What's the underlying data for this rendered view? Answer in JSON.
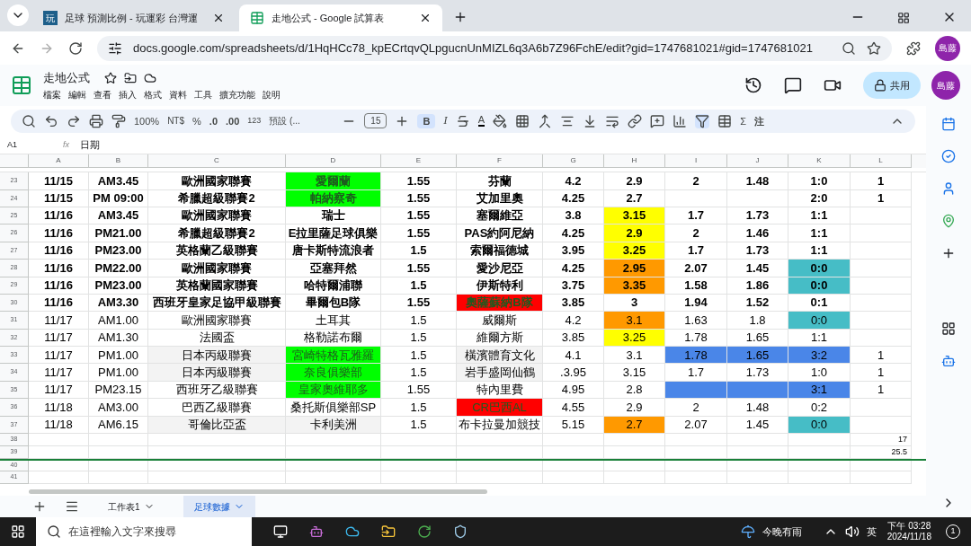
{
  "browser": {
    "tabs": [
      {
        "label": "足球 預測比例 - 玩運彩 台灣運",
        "icon_text": "玩",
        "selected": false
      },
      {
        "label": "走地公式 - Google 試算表",
        "selected": true
      }
    ],
    "url": "docs.google.com/spreadsheets/d/1HqHCc78_kpECrtqvQLpgucnUnMIZL6q3A6b7Z96FchE/edit?gid=1747681021#gid=1747681021",
    "profile": "島藤"
  },
  "doc": {
    "title": "走地公式",
    "menus": [
      "檔案",
      "編輯",
      "查看",
      "插入",
      "格式",
      "資料",
      "工具",
      "擴充功能",
      "說明"
    ],
    "share": "共用",
    "avatar": "島藤"
  },
  "toolbar": {
    "zoom": "100%",
    "currency": "NT$",
    "percent": "%",
    "dec_less": ".0",
    "dec_more": ".00",
    "format": "123",
    "font": "預設 (...",
    "font_size": "15",
    "bold": "B",
    "italic": "I",
    "text_color": "A",
    "sum": "Σ",
    "note": "注"
  },
  "formula_bar": {
    "cell": "A1",
    "fx": "fx",
    "value": "日期"
  },
  "columns": [
    "A",
    "B",
    "C",
    "D",
    "E",
    "F",
    "G",
    "H",
    "I",
    "J",
    "K",
    "L"
  ],
  "rows": [
    {
      "num": "23",
      "bold": true,
      "cells": [
        {
          "text": "11/15"
        },
        {
          "text": "AM3.45"
        },
        {
          "text": "歐洲國家聯賽"
        },
        {
          "text": "愛爾蘭",
          "color": "#00ff00"
        },
        {
          "text": "1.55"
        },
        {
          "text": "芬蘭"
        },
        {
          "text": "4.2"
        },
        {
          "text": "2.9"
        },
        {
          "text": "2"
        },
        {
          "text": "1.48"
        },
        {
          "text": "1:0"
        },
        {
          "text": "1"
        }
      ]
    },
    {
      "num": "24",
      "bold": true,
      "cells": [
        {
          "text": "11/15"
        },
        {
          "text": "PM 09:00"
        },
        {
          "text": "希臘超級聯賽2"
        },
        {
          "text": "帕納察奇",
          "color": "#00ff00"
        },
        {
          "text": "1.55"
        },
        {
          "text": "艾加里奧"
        },
        {
          "text": "4.25"
        },
        {
          "text": "2.7"
        },
        {},
        {},
        {
          "text": "2:0"
        },
        {
          "text": "1"
        }
      ]
    },
    {
      "num": "25",
      "bold": true,
      "cells": [
        {
          "text": "11/16"
        },
        {
          "text": "AM3.45"
        },
        {
          "text": "歐洲國家聯賽"
        },
        {
          "text": "瑞士"
        },
        {
          "text": "1.55"
        },
        {
          "text": "塞爾維亞"
        },
        {
          "text": "3.8"
        },
        {
          "text": "3.15",
          "color": "#ffff00"
        },
        {
          "text": "1.7"
        },
        {
          "text": "1.73"
        },
        {
          "text": "1:1"
        },
        {}
      ]
    },
    {
      "num": "26",
      "bold": true,
      "cells": [
        {
          "text": "11/16"
        },
        {
          "text": "PM21.00"
        },
        {
          "text": "希臘超級聯賽2"
        },
        {
          "text": "E拉里薩足球俱樂"
        },
        {
          "text": "1.55"
        },
        {
          "text": "PAS約阿尼納"
        },
        {
          "text": "4.25"
        },
        {
          "text": "2.9",
          "color": "#ffff00"
        },
        {
          "text": "2"
        },
        {
          "text": "1.46"
        },
        {
          "text": "1:1"
        },
        {}
      ]
    },
    {
      "num": "27",
      "bold": true,
      "cells": [
        {
          "text": "11/16"
        },
        {
          "text": "PM23.00"
        },
        {
          "text": "英格蘭乙級聯賽"
        },
        {
          "text": "唐卡斯特流浪者"
        },
        {
          "text": "1.5"
        },
        {
          "text": "索爾福德城"
        },
        {
          "text": "3.95"
        },
        {
          "text": "3.25",
          "color": "#ffff00"
        },
        {
          "text": "1.7"
        },
        {
          "text": "1.73"
        },
        {
          "text": "1:1"
        },
        {}
      ]
    },
    {
      "num": "28",
      "bold": true,
      "cells": [
        {
          "text": "11/16"
        },
        {
          "text": "PM22.00"
        },
        {
          "text": "歐洲國家聯賽"
        },
        {
          "text": "亞塞拜然"
        },
        {
          "text": "1.55"
        },
        {
          "text": "愛沙尼亞"
        },
        {
          "text": "4.25"
        },
        {
          "text": "2.95",
          "color": "#ff9900"
        },
        {
          "text": "2.07"
        },
        {
          "text": "1.45"
        },
        {
          "text": "0:0",
          "color": "#46bdc6"
        },
        {}
      ]
    },
    {
      "num": "29",
      "bold": true,
      "cells": [
        {
          "text": "11/16"
        },
        {
          "text": "PM23.00"
        },
        {
          "text": "英格蘭國家聯賽"
        },
        {
          "text": "哈特爾浦聯"
        },
        {
          "text": "1.5"
        },
        {
          "text": "伊斯特利"
        },
        {
          "text": "3.75"
        },
        {
          "text": "3.35",
          "color": "#ff9900"
        },
        {
          "text": "1.58"
        },
        {
          "text": "1.86"
        },
        {
          "text": "0:0",
          "color": "#46bdc6"
        },
        {}
      ]
    },
    {
      "num": "30",
      "bold": true,
      "cells": [
        {
          "text": "11/16"
        },
        {
          "text": "AM3.30"
        },
        {
          "text": "西班牙皇家足協甲級聯賽"
        },
        {
          "text": "畢爾包B隊"
        },
        {
          "text": "1.55"
        },
        {
          "text": "奧薩蘇納B隊",
          "color": "#ff0000"
        },
        {
          "text": "3.85"
        },
        {
          "text": "3"
        },
        {
          "text": "1.94"
        },
        {
          "text": "1.52"
        },
        {
          "text": "0:1"
        },
        {}
      ]
    },
    {
      "num": "31",
      "bold": false,
      "cells": [
        {
          "text": "11/17"
        },
        {
          "text": "AM1.00"
        },
        {
          "text": "歐洲國家聯賽"
        },
        {
          "text": "土耳其"
        },
        {
          "text": "1.5"
        },
        {
          "text": "威爾斯"
        },
        {
          "text": "4.2"
        },
        {
          "text": "3.1",
          "color": "#ff9900"
        },
        {
          "text": "1.63"
        },
        {
          "text": "1.8"
        },
        {
          "text": "0:0",
          "color": "#46bdc6"
        },
        {}
      ]
    },
    {
      "num": "32",
      "bold": false,
      "cells": [
        {
          "text": "11/17"
        },
        {
          "text": "AM1.30"
        },
        {
          "text": "法國盃"
        },
        {
          "text": "格勒諾布爾"
        },
        {
          "text": "1.5"
        },
        {
          "text": "維爾方斯"
        },
        {
          "text": "3.85"
        },
        {
          "text": "3.25",
          "color": "#ffff00"
        },
        {
          "text": "1.78"
        },
        {
          "text": "1.65"
        },
        {
          "text": "1:1"
        },
        {}
      ]
    },
    {
      "num": "33",
      "bold": false,
      "cells": [
        {
          "text": "11/17"
        },
        {
          "text": "PM1.00"
        },
        {
          "text": "日本丙級聯賽",
          "color": "#f3f3f3"
        },
        {
          "text": "宮崎特格瓦雅羅",
          "color": "#00ff00"
        },
        {
          "text": "1.5"
        },
        {
          "text": "橫濱體育文化",
          "color": "#f3f3f3"
        },
        {
          "text": "4.1"
        },
        {
          "text": "3.1"
        },
        {
          "text": "1.78",
          "color": "#4a86e8"
        },
        {
          "text": "1.65",
          "color": "#4a86e8"
        },
        {
          "text": "3:2",
          "color": "#4a86e8"
        },
        {
          "text": "1"
        }
      ]
    },
    {
      "num": "34",
      "bold": false,
      "cells": [
        {
          "text": "11/17"
        },
        {
          "text": "PM1.00"
        },
        {
          "text": "日本丙級聯賽",
          "color": "#f3f3f3"
        },
        {
          "text": "奈良俱樂部",
          "color": "#00ff00"
        },
        {
          "text": "1.5"
        },
        {
          "text": "岩手盛岡仙鶴",
          "color": "#f3f3f3"
        },
        {
          "text": ".3.95"
        },
        {
          "text": "3.15"
        },
        {
          "text": "1.7"
        },
        {
          "text": "1.73"
        },
        {
          "text": "1:0"
        },
        {
          "text": "1"
        }
      ]
    },
    {
      "num": "35",
      "bold": false,
      "cells": [
        {
          "text": "11/17"
        },
        {
          "text": "PM23.15"
        },
        {
          "text": "西班牙乙級聯賽"
        },
        {
          "text": "皇家奧維耶多",
          "color": "#00ff00"
        },
        {
          "text": "1.55"
        },
        {
          "text": "特內里費"
        },
        {
          "text": "4.95"
        },
        {
          "text": "2.8"
        },
        {
          "color": "#4a86e8"
        },
        {
          "color": "#4a86e8"
        },
        {
          "text": "3:1",
          "color": "#4a86e8"
        },
        {
          "text": "1"
        }
      ]
    },
    {
      "num": "36",
      "bold": false,
      "cells": [
        {
          "text": "11/18"
        },
        {
          "text": "AM3.00"
        },
        {
          "text": "巴西乙級聯賽"
        },
        {
          "text": "桑托斯俱樂部SP"
        },
        {
          "text": "1.5"
        },
        {
          "text": "CR巴西AL",
          "color": "#ff0000"
        },
        {
          "text": "4.55"
        },
        {
          "text": "2.9"
        },
        {
          "text": "2"
        },
        {
          "text": "1.48"
        },
        {
          "text": "0:2"
        },
        {}
      ]
    },
    {
      "num": "37",
      "bold": false,
      "cells": [
        {
          "text": "11/18"
        },
        {
          "text": "AM6.15"
        },
        {
          "text": "哥倫比亞盃",
          "color": "#f3f3f3"
        },
        {
          "text": "卡利美洲",
          "color": "#f3f3f3"
        },
        {
          "text": "1.5"
        },
        {
          "text": "布卡拉曼加競技"
        },
        {
          "text": "5.15"
        },
        {
          "text": "2.7",
          "color": "#ff9900"
        },
        {
          "text": "2.07"
        },
        {
          "text": "1.45"
        },
        {
          "text": "0:0",
          "color": "#46bdc6"
        },
        {}
      ]
    },
    {
      "num": "38",
      "small": true,
      "cells": [
        {},
        {},
        {},
        {},
        {},
        {},
        {},
        {},
        {},
        {},
        {},
        {
          "text": "17"
        }
      ]
    },
    {
      "num": "39",
      "small": true,
      "cells": [
        {},
        {},
        {},
        {},
        {},
        {},
        {},
        {},
        {},
        {},
        {},
        {
          "text": "25.5"
        }
      ]
    },
    {
      "num": "40",
      "small": true,
      "cells": []
    },
    {
      "num": "41",
      "small": true,
      "cells": []
    }
  ],
  "sheet_tabs": [
    {
      "label": "工作表1",
      "selected": false
    },
    {
      "label": "足球數據",
      "selected": true
    }
  ],
  "taskbar": {
    "search": "在這裡輸入文字來搜尋",
    "weather": "今晚有雨",
    "ime": "英",
    "time": "下午 03:28",
    "date": "2024/11/18",
    "notifications": "1"
  }
}
